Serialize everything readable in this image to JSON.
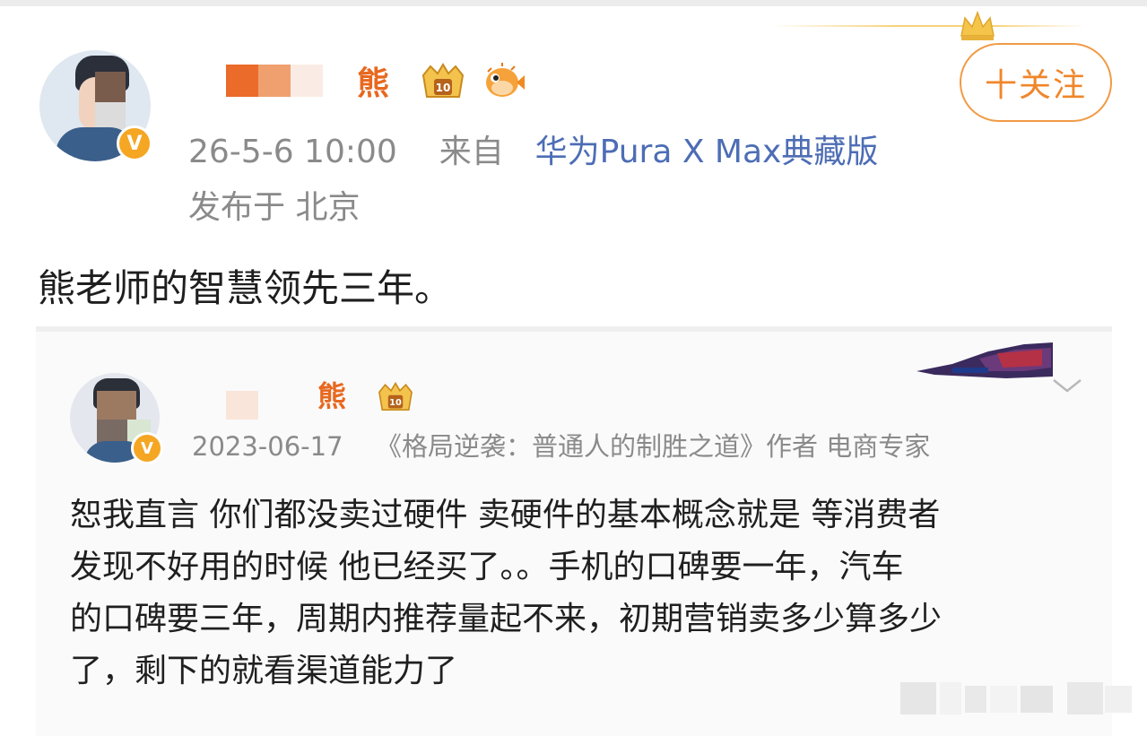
{
  "post": {
    "author_suffix": "熊",
    "time": "26-5-6 10:00",
    "source_prefix": "来自",
    "source_device": "华为Pura X Max典藏版",
    "location": "发布于 北京",
    "text": "熊老师的智慧领先三年。",
    "follow_label": "十关注",
    "verified_badge": "V"
  },
  "repost": {
    "author_suffix": "熊",
    "date": "2023-06-17",
    "bio": "《格局逆袭：普通人的制胜之道》作者 电商专家",
    "verified_badge": "V",
    "text_lines": [
      "恕我直言 你们都没卖过硬件 卖硬件的基本概念就是 等消费者",
      "发现不好用的时候 他已经买了。。手机的口碑要一年，汽车",
      "的口碑要三年，周期内推荐量起不来，初期营销卖多少算多少",
      "了，剩下的就看渠道能力了"
    ]
  },
  "icons": {
    "crown": "crown-icon",
    "level_badge": "level-10-badge-icon",
    "fish": "pufferfish-emoji-icon",
    "chevron": "chevron-down-icon"
  },
  "colors": {
    "accent_orange": "#f0862a",
    "link_blue": "#4d6db5",
    "meta_gray": "#8a8a8a"
  }
}
